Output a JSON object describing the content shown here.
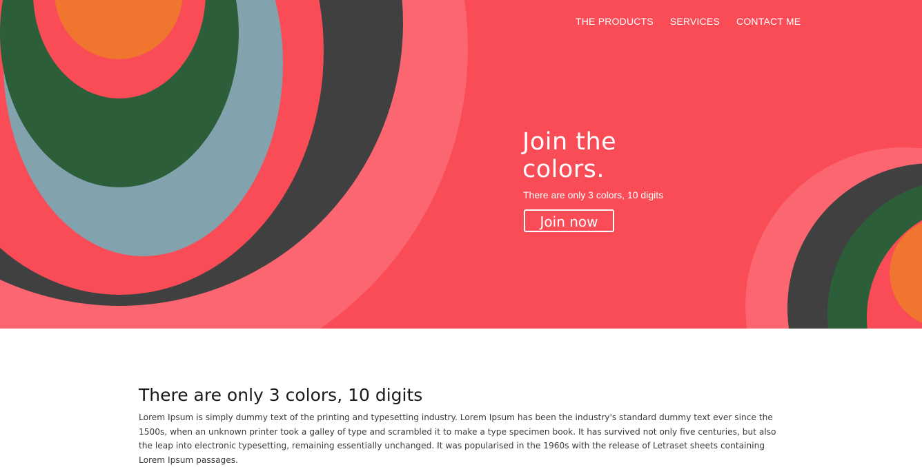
{
  "nav": {
    "items": [
      {
        "label": "THE PRODUCTS"
      },
      {
        "label": "SERVICES"
      },
      {
        "label": "CONTACT ME"
      }
    ]
  },
  "hero": {
    "title": "Join the colors.",
    "subtitle": "There are only 3 colors, 10 digits",
    "cta_label": "Join now"
  },
  "main": {
    "heading": "There are only 3 colors, 10 digits",
    "body": "Lorem Ipsum is simply dummy text of the printing and typesetting industry. Lorem Ipsum has been the industry's standard dummy text ever since the 1500s, when an unknown printer took a galley of type and scrambled it to make a type specimen book. It has survived not only five centuries, but also the leap into electronic typesetting, remaining essentially unchanged. It was popularised in the 1960s with the release of Letraset sheets containing Lorem Ipsum passages."
  },
  "colors": {
    "hero_bg": "#f94c57",
    "light_red": "#fb6670",
    "charcoal": "#404040",
    "slate_blue": "#82a3ad",
    "dark_green": "#2d5e3a",
    "orange": "#f0752f"
  }
}
